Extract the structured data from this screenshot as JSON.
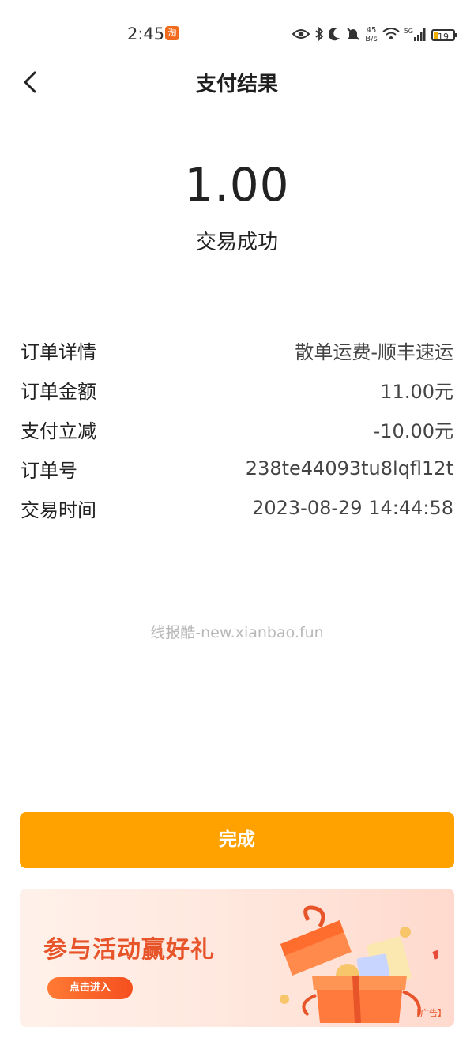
{
  "status_bar": {
    "time": "2:45",
    "app_icon_glyph": "淘",
    "speed_value": "45",
    "speed_unit": "B/s",
    "network": "5G",
    "battery": "19"
  },
  "nav": {
    "title": "支付结果"
  },
  "payment": {
    "amount": "1.00",
    "status": "交易成功"
  },
  "details": [
    {
      "label": "订单详情",
      "value": "散单运费-顺丰速运"
    },
    {
      "label": "订单金额",
      "value": "11.00元"
    },
    {
      "label": "支付立减",
      "value": "-10.00元"
    },
    {
      "label": "订单号",
      "value": "238te44093tu8lqfl12t"
    },
    {
      "label": "交易时间",
      "value": "2023-08-29 14:44:58"
    }
  ],
  "watermark": "线报酷-new.xianbao.fun",
  "done_button": "完成",
  "banner": {
    "title": "参与活动赢好礼",
    "cta": "点击进入",
    "ad_tag": "【广告】",
    "accent": "#e8542a"
  },
  "colors": {
    "primary_button": "#ffa200",
    "text": "#222222"
  }
}
